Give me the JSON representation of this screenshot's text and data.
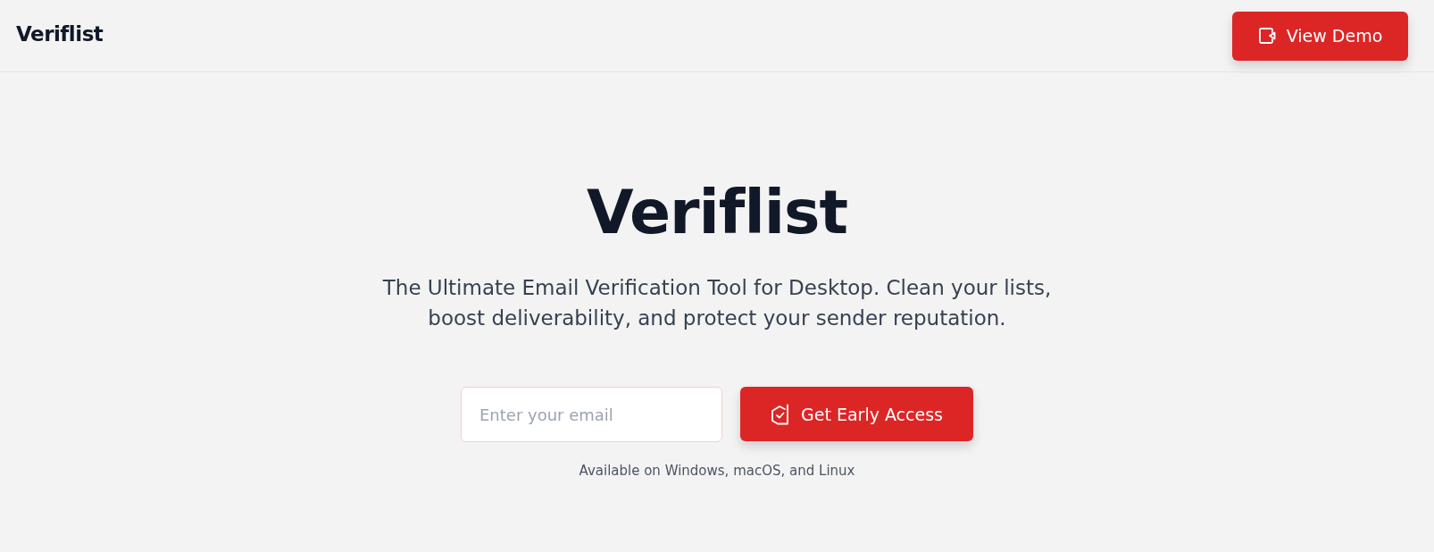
{
  "header": {
    "logo": "Veriflist",
    "demo_button": {
      "label": "View Demo"
    }
  },
  "hero": {
    "title": "Veriflist",
    "subtitle": "The Ultimate Email Verification Tool for Desktop. Clean your lists, boost deliverability, and protect your sender reputation.",
    "email_field": {
      "placeholder": "Enter your email"
    },
    "cta_button": {
      "label": "Get Early Access"
    },
    "availability": "Available on Windows, macOS, and Linux"
  }
}
